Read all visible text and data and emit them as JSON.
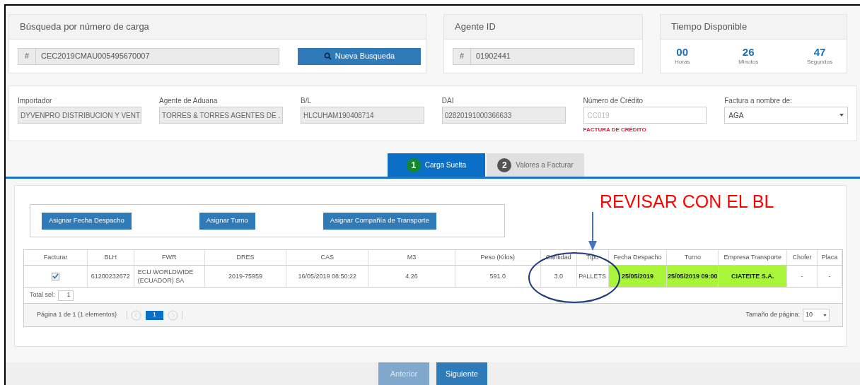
{
  "search_card": {
    "title": "Búsqueda por número de carga",
    "prefix": "#",
    "value": "CEC2019CMAU005495670007",
    "button": "Nueva Busqueda"
  },
  "agent_card": {
    "title": "Agente ID",
    "prefix": "#",
    "value": "01902441"
  },
  "time_card": {
    "title": "Tiempo Disponible",
    "units": [
      {
        "value": "00",
        "label": "Horas"
      },
      {
        "value": "26",
        "label": "Minutos"
      },
      {
        "value": "47",
        "label": "Segundos"
      }
    ]
  },
  "fields": [
    {
      "kind": "readonly",
      "label": "Importador",
      "value": "DYVENPRO DISTRIBUCION Y VENT"
    },
    {
      "kind": "readonly",
      "label": "Agente de Aduana",
      "value": "TORRES & TORRES AGENTES DE ."
    },
    {
      "kind": "readonly",
      "label": "B/L",
      "value": "HLCUHAM190408714"
    },
    {
      "kind": "readonly",
      "label": "DAI",
      "value": "02820191000366633"
    },
    {
      "kind": "input",
      "label": "Número de Crédito",
      "placeholder": "CC019",
      "note": "FACTURA DE CRÉDITO"
    },
    {
      "kind": "select",
      "label": "Factura a nombre de:",
      "value": "AGA"
    }
  ],
  "tabs": [
    {
      "number": "1",
      "label": "Carga Suelta",
      "selected": true
    },
    {
      "number": "2",
      "label": "Valores a Facturar",
      "selected": false
    }
  ],
  "action_buttons": [
    "Asignar Fecha Despacho",
    "Asignar Turno",
    "Asignar Compañía de Transporte"
  ],
  "table": {
    "columns": [
      "Facturar",
      "BLH",
      "FWR",
      "DRES",
      "CAS",
      "M3",
      "Peso (Kilos)",
      "Cantidad",
      "Tipo",
      "Fecha Despacho",
      "Turno",
      "Empresa Transporte",
      "Chofer",
      "Placa"
    ],
    "rows": [
      {
        "cells": [
          {
            "kind": "checkbox",
            "checked": true
          },
          {
            "kind": "text",
            "text": "61200232672",
            "highlighted": false
          },
          {
            "kind": "text",
            "text": "ECU WORLDWIDE (ECUADOR) SA",
            "highlighted": false
          },
          {
            "kind": "text",
            "text": "2019-75959",
            "highlighted": false
          },
          {
            "kind": "text",
            "text": "16/05/2019 08:50:22",
            "highlighted": false
          },
          {
            "kind": "text",
            "text": "4.26",
            "highlighted": false
          },
          {
            "kind": "text",
            "text": "591.0",
            "highlighted": false
          },
          {
            "kind": "text",
            "text": "3.0",
            "highlighted": false
          },
          {
            "kind": "text",
            "text": "PALLETS",
            "highlighted": false
          },
          {
            "kind": "text",
            "text": "25/05/2019",
            "highlighted": true
          },
          {
            "kind": "text",
            "text": "25/05/2019 09:00",
            "highlighted": true
          },
          {
            "kind": "text",
            "text": "CIATEITE S.A.",
            "highlighted": true
          },
          {
            "kind": "text",
            "text": "-",
            "highlighted": false
          },
          {
            "kind": "text",
            "text": "-",
            "highlighted": false
          }
        ]
      }
    ],
    "total_label": "Total sel:",
    "total_value": "1"
  },
  "pager": {
    "info": "Página 1 de 1 (1 elementos)",
    "pages": [
      {
        "label": "1",
        "selected": true
      }
    ],
    "size_label": "Tamaño de página:",
    "size_value": "10"
  },
  "annotation": {
    "text": "REVISAR CON EL BL"
  },
  "nav_buttons": [
    {
      "label": "Anterior",
      "disabled": true
    },
    {
      "label": "Siguiente",
      "disabled": false
    }
  ]
}
